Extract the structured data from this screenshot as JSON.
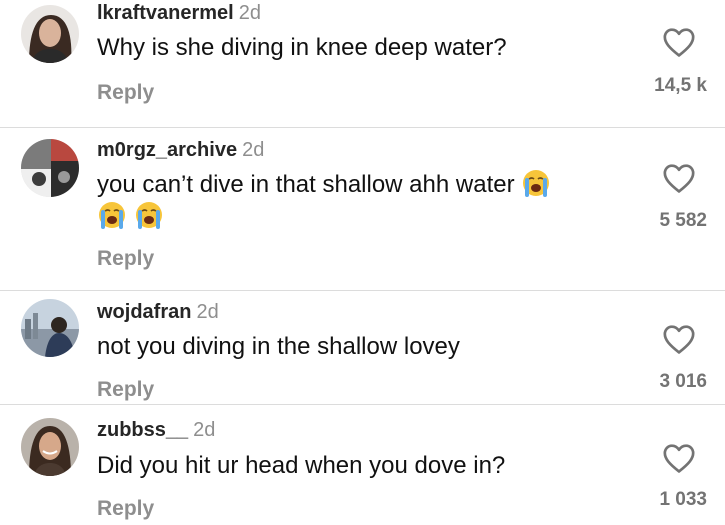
{
  "comments": [
    {
      "username": "lkraftvanermel",
      "age": "2d",
      "text": "Why is she diving in knee deep water?",
      "reply_label": "Reply",
      "like_count": "14,5 k",
      "avatar_icon": "profile-photo-woman-dark-hair"
    },
    {
      "username": "m0rgz_archive",
      "age": "2d",
      "text_line1": "you can’t dive in that shallow ahh water",
      "emoji_icon": "loudly-crying-face",
      "reply_label": "Reply",
      "like_count": "5 582",
      "avatar_icon": "profile-photo-collage"
    },
    {
      "username": "wojdafran",
      "age": "2d",
      "text": "not you diving in the shallow lovey",
      "reply_label": "Reply",
      "like_count": "3 016",
      "avatar_icon": "profile-photo-city-view"
    },
    {
      "username": "zubbss__",
      "age": "2d",
      "text": "Did you hit ur head when you dove in?",
      "reply_label": "Reply",
      "like_count": "1 033",
      "avatar_icon": "profile-photo-woman-smiling"
    }
  ],
  "colors": {
    "username": "#262626",
    "secondary": "#8e8e8e",
    "divider": "#dcdcdc"
  }
}
